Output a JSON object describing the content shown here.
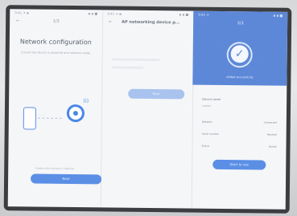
{
  "panel1": {
    "status_left": "9:41 ✈ ▪",
    "status_right": "▪ ▪ ■",
    "back": "←",
    "step": "1/3",
    "title": "Network configuration",
    "subtitle": "Ensure the device is powered and network ready",
    "link_label": "- - -",
    "hint": "Confirm the indicator is blinking",
    "button_label": "Next"
  },
  "panel2": {
    "status_left": "9:41 ✈ ▪",
    "status_right": "▪ ▪ ■",
    "back": "←",
    "title": "AP networking device p...",
    "button_label": "Next"
  },
  "panel3": {
    "status_left": "9:41 ✈",
    "status_right": "▪ ▪ ■",
    "step": "3/3",
    "success_text": "Added successfully",
    "section_title": "Device name",
    "section_value": "camera",
    "rows": [
      {
        "l": "Network",
        "r": "Connected"
      },
      {
        "l": "Serial number",
        "r": "Fetched"
      },
      {
        "l": "Status",
        "r": "Online"
      }
    ],
    "button_label": "Start to use"
  },
  "colors": {
    "accent": "#5b8fe6",
    "hero": "#5d88d8",
    "screen": "#f5f6f8"
  },
  "icons": [
    "phone-icon",
    "camera-icon",
    "wifi-icon",
    "check-icon"
  ]
}
